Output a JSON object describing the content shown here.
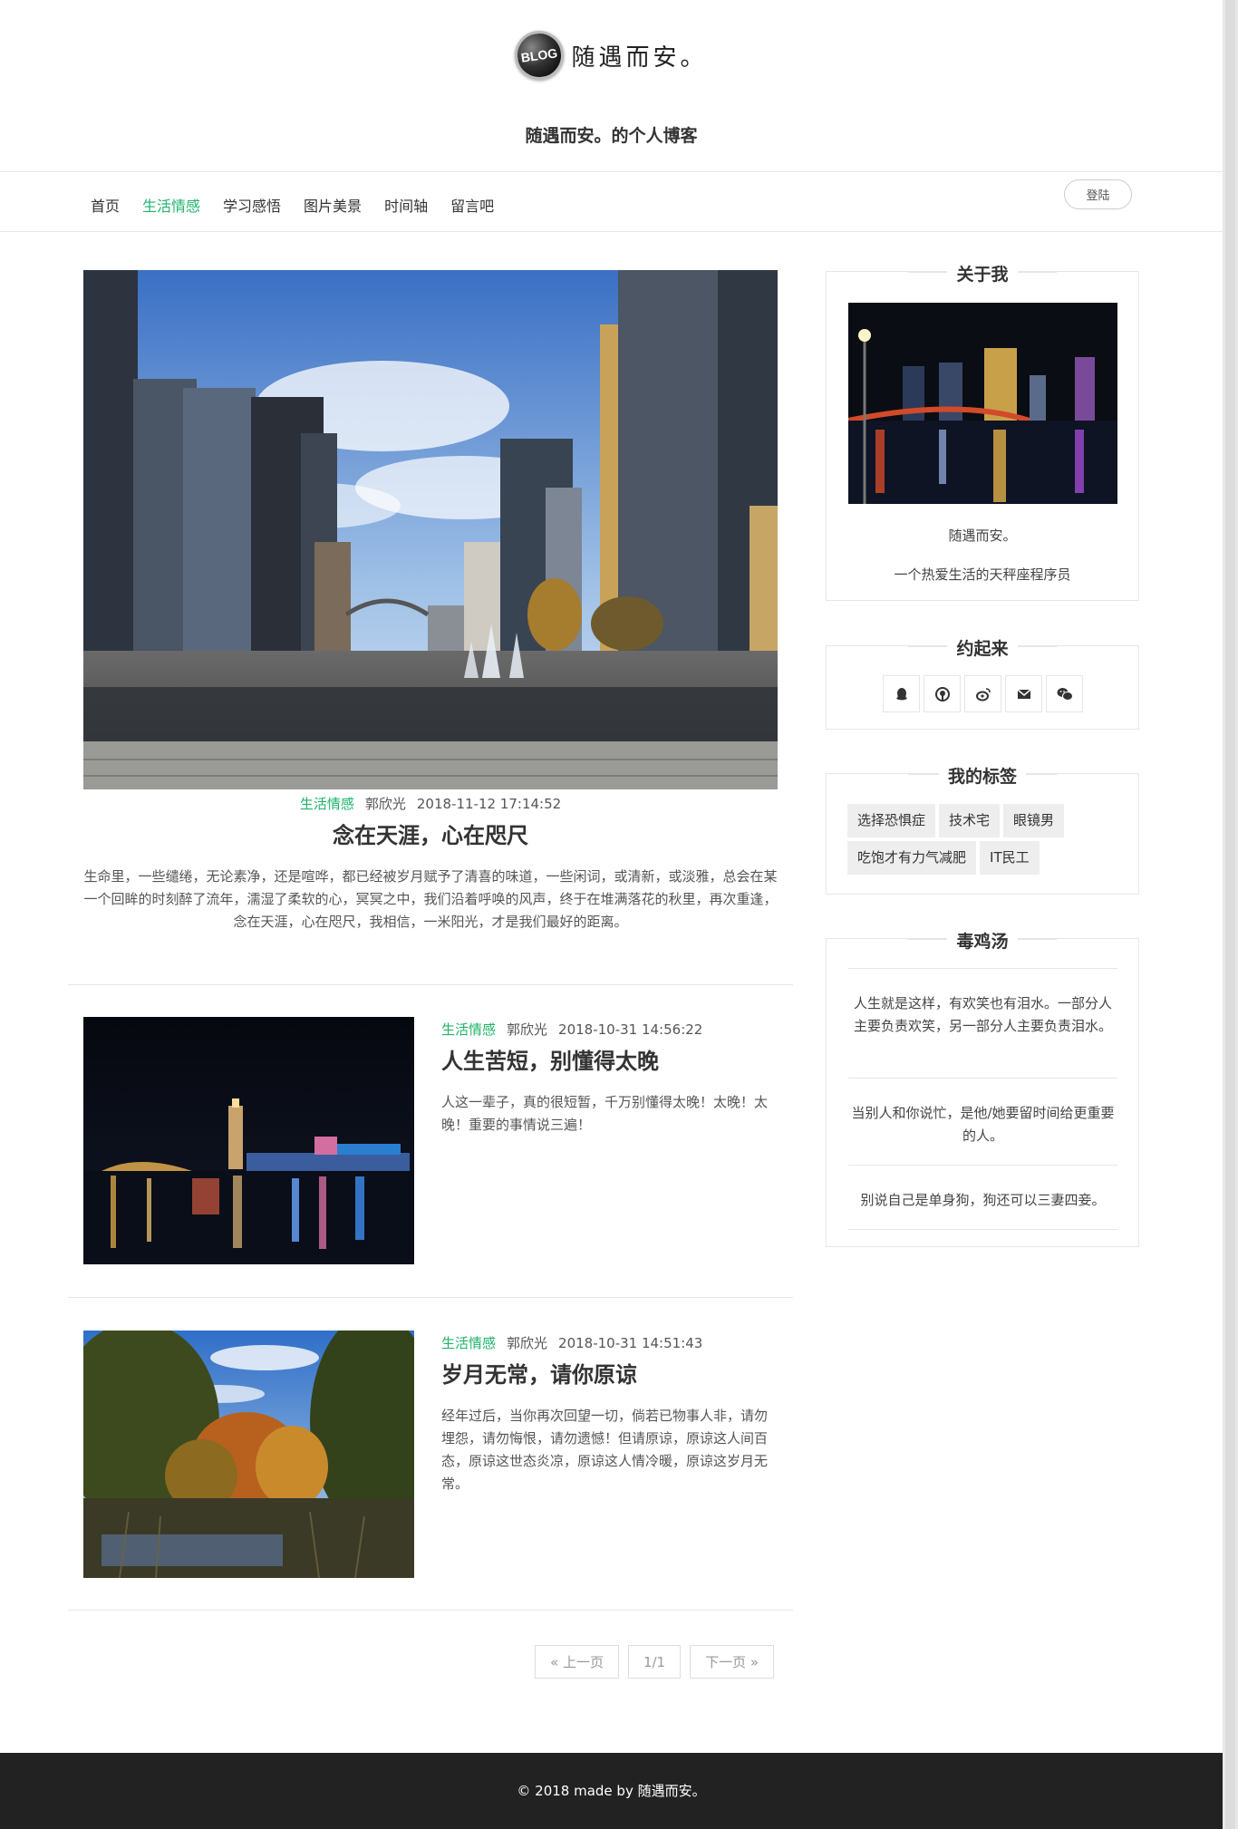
{
  "header": {
    "logo_badge": "BLOG",
    "logo_text": "随遇而安。",
    "subtitle": "随遇而安。的个人博客"
  },
  "nav": {
    "items": [
      {
        "label": "首页",
        "active": false
      },
      {
        "label": "生活情感",
        "active": true
      },
      {
        "label": "学习感悟",
        "active": false
      },
      {
        "label": "图片美景",
        "active": false
      },
      {
        "label": "时间轴",
        "active": false
      },
      {
        "label": "留言吧",
        "active": false
      }
    ],
    "login_label": "登陆"
  },
  "featured": {
    "category": "生活情感",
    "author": "郭欣光",
    "date": "2018-11-12 17:14:52",
    "title": "念在天涯，心在咫尺",
    "excerpt": "生命里，一些缱绻，无论素净，还是喧哗，都已经被岁月赋予了清喜的味道，一些闲词，或清新，或淡雅，总会在某一个回眸的时刻醉了流年，濡湿了柔软的心，冥冥之中，我们沿着呼唤的风声，终于在堆满落花的秋里，再次重逢，念在天涯，心在咫尺，我相信，一米阳光，才是我们最好的距离。"
  },
  "posts": [
    {
      "category": "生活情感",
      "author": "郭欣光",
      "date": "2018-10-31 14:56:22",
      "title": "人生苦短，别懂得太晚",
      "excerpt": "人这一辈子，真的很短暂，千万别懂得太晚！太晚！太晚！重要的事情说三遍！"
    },
    {
      "category": "生活情感",
      "author": "郭欣光",
      "date": "2018-10-31 14:51:43",
      "title": "岁月无常，请你原谅",
      "excerpt": "经年过后，当你再次回望一切，倘若已物事人非，请勿埋怨，请勿悔恨，请勿遗憾！但请原谅，原谅这人间百态，原谅这世态炎凉，原谅这人情冷暖，原谅这岁月无常。"
    }
  ],
  "pager": {
    "prev": "« 上一页",
    "current": "1/1",
    "next": "下一页 »"
  },
  "sidebar": {
    "about": {
      "title": "关于我",
      "name": "随遇而安。",
      "desc": "一个热爱生活的天秤座程序员"
    },
    "contact": {
      "title": "约起来",
      "icons": [
        "qq-icon",
        "github-icon",
        "weibo-icon",
        "email-icon",
        "wechat-icon"
      ]
    },
    "tags": {
      "title": "我的标签",
      "items": [
        "选择恐惧症",
        "技术宅",
        "眼镜男",
        "吃饱才有力气减肥",
        "IT民工"
      ]
    },
    "quotes": {
      "title": "毒鸡汤",
      "items": [
        "人生就是这样，有欢笑也有泪水。一部分人主要负责欢笑，另一部分人主要负责泪水。",
        "当别人和你说忙，是他/她要留时间给更重要的人。",
        "别说自己是单身狗，狗还可以三妻四妾。"
      ]
    }
  },
  "footer": {
    "text": "© 2018 made by 随遇而安。"
  },
  "colors": {
    "accent": "#1fb36b",
    "footer_bg": "#222222"
  }
}
